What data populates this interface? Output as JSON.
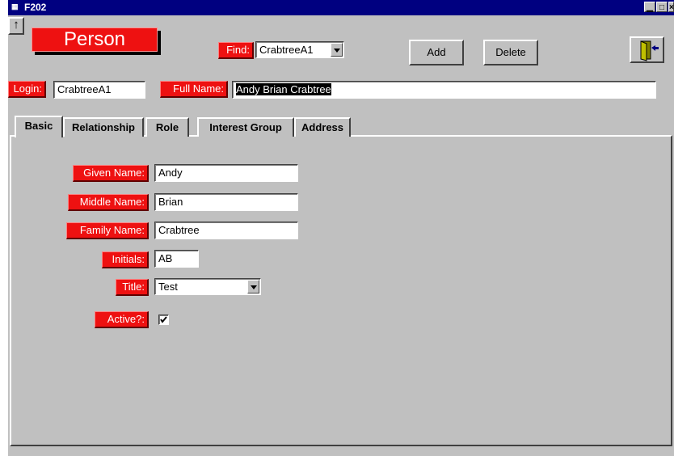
{
  "window": {
    "title": "F202",
    "controls": {
      "minimize": "▁",
      "maximize": "□",
      "close": "×"
    }
  },
  "header": {
    "up_icon": "↑",
    "form_title": "Person",
    "find_label": "Find:",
    "find_value": "CrabtreeA1",
    "add_label": "Add",
    "delete_label": "Delete",
    "exit_icon": "exit-door-icon"
  },
  "record": {
    "login_label": "Login:",
    "login_value": "CrabtreeA1",
    "full_name_label": "Full Name:",
    "full_name_value": "Andy Brian Crabtree"
  },
  "tabs": [
    {
      "label": "Basic",
      "active": true
    },
    {
      "label": "Relationship",
      "active": false
    },
    {
      "label": "Role",
      "active": false
    },
    {
      "label": "Interest Group",
      "active": false
    },
    {
      "label": "Address",
      "active": false
    }
  ],
  "basic": {
    "given_name_label": "Given Name:",
    "given_name_value": "Andy",
    "middle_name_label": "Middle Name:",
    "middle_name_value": "Brian",
    "family_name_label": "Family Name:",
    "family_name_value": "Crabtree",
    "initials_label": "Initials:",
    "initials_value": "AB",
    "title_label": "Title:",
    "title_value": "Test",
    "active_label": "Active?:",
    "active_checked": true
  },
  "colors": {
    "label_red": "#ee1111",
    "titlebar_navy": "#000080",
    "window_gray": "#c0c0c0"
  }
}
